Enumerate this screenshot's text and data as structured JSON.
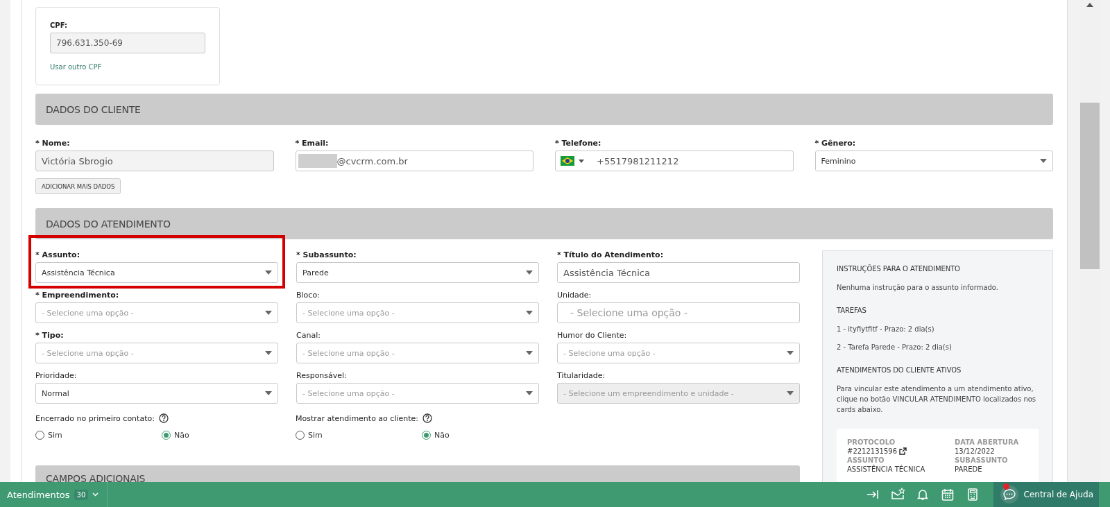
{
  "cpf": {
    "label": "CPF:",
    "value": "796.631.350-69",
    "link": "Usar outro CPF"
  },
  "client_section": {
    "title": "DADOS DO CLIENTE",
    "fields": [
      {
        "label": "* Nome:",
        "required": true,
        "kind": "input",
        "value": "Victória Sbrogio",
        "readonly": true
      },
      {
        "label": "* Email:",
        "required": true,
        "kind": "input",
        "value": "@cvcrm.com.br",
        "redacted_prefix": true,
        "readonly": false
      },
      {
        "label": "* Telefone:",
        "required": true,
        "kind": "phone",
        "value": "+5517981211212"
      },
      {
        "label": "* Gênero:",
        "required": true,
        "kind": "select",
        "value": "Feminino",
        "disabled": false
      }
    ],
    "button": "ADICIONAR MAIS DADOS"
  },
  "service_section": {
    "title": "DADOS DO ATENDIMENTO",
    "fields": [
      {
        "label": "* Assunto:",
        "required": true,
        "kind": "select",
        "value": "Assistência Técnica",
        "disabled": false,
        "highlighted": true
      },
      {
        "label": "* Subassunto:",
        "required": true,
        "kind": "select",
        "value": "Parede",
        "disabled": false
      },
      {
        "label": "* Título do Atendimento:",
        "required": true,
        "kind": "input",
        "value": "Assistência Técnica",
        "readonly": false
      },
      {
        "label": "* Empreendimento:",
        "required": true,
        "kind": "select",
        "placeholder": "- Selecione uma opção -",
        "disabled": false
      },
      {
        "label": "Bloco:",
        "required": false,
        "kind": "select",
        "placeholder": "- Selecione uma opção -",
        "disabled": false
      },
      {
        "label": "Unidade:",
        "required": false,
        "kind": "input",
        "placeholder": "- Selecione uma opção -",
        "readonly": false
      },
      {
        "label": "* Tipo:",
        "required": true,
        "kind": "select",
        "placeholder": "- Selecione uma opção -",
        "disabled": false
      },
      {
        "label": "Canal:",
        "required": false,
        "kind": "select",
        "placeholder": "- Selecione uma opção -",
        "disabled": false
      },
      {
        "label": "Humor do Cliente:",
        "required": false,
        "kind": "select",
        "placeholder": "- Selecione uma opção -",
        "disabled": false
      },
      {
        "label": "Prioridade:",
        "required": false,
        "kind": "select",
        "value": "Normal",
        "disabled": false
      },
      {
        "label": "Responsável:",
        "required": false,
        "kind": "select",
        "placeholder": "- Selecione uma opção -",
        "disabled": false
      },
      {
        "label": "Titularidade:",
        "required": false,
        "kind": "select",
        "placeholder": "- Selecione um empreendimento e unidade -",
        "disabled": true
      }
    ],
    "radio_groups": [
      {
        "label": "Encerrado no primeiro contato:",
        "help": true,
        "options": [
          {
            "label": "Sim",
            "selected": false
          },
          {
            "label": "Não",
            "selected": true
          }
        ]
      },
      {
        "label": "Mostrar atendimento ao cliente:",
        "help": true,
        "options": [
          {
            "label": "Sim",
            "selected": false
          },
          {
            "label": "Não",
            "selected": true
          }
        ]
      }
    ],
    "instructions": {
      "blocks": [
        {
          "heading": "INSTRUÇÕES PARA O ATENDIMENTO",
          "lines": [
            "Nenhuma instrução para o assunto informado."
          ]
        },
        {
          "heading": "TAREFAS",
          "lines": [
            "1 - ityfiytfitf - Prazo: 2 dia(s)",
            "2 - Tarefa Parede - Prazo: 2 dia(s)"
          ]
        },
        {
          "heading": "ATENDIMENTOS DO CLIENTE ATIVOS",
          "lines": [
            "Para vincular este atendimento a um atendimento ativo, clique no botão VINCULAR ATENDIMENTO localizados nos cards abaixo."
          ]
        }
      ],
      "card": [
        {
          "label": "PROTOCOLO",
          "value": "#2212131596",
          "link": true
        },
        {
          "label": "DATA ABERTURA",
          "value": "13/12/2022"
        },
        {
          "label": "ASSUNTO",
          "value": "ASSISTÊNCIA TÉCNICA"
        },
        {
          "label": "SUBASSUNTO",
          "value": "PAREDE"
        }
      ]
    }
  },
  "extra_section": {
    "title": "CAMPOS ADICIONAIS"
  },
  "bottom_bar": {
    "label": "Atendimentos",
    "count": "30",
    "tools": [
      {
        "kind": "collapse"
      },
      {
        "kind": "mail-star"
      },
      {
        "kind": "bell"
      },
      {
        "kind": "calendar"
      },
      {
        "kind": "calculator"
      }
    ],
    "help": {
      "label": "Central de Ajuda",
      "notification": true
    }
  }
}
